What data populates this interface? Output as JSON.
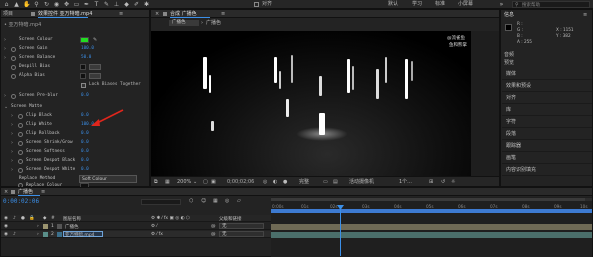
{
  "toolbar": {
    "snap_label": "对齐",
    "workspaces": [
      "默认",
      "学习",
      "标准",
      "小屏幕"
    ],
    "search_placeholder": "搜索帮助"
  },
  "left_panel": {
    "project_tab": "项目",
    "effects_tab": "效果控件 亚万特暗.mp4",
    "layer_label": "• 亚万特暗.mp4",
    "color_swatch": "#22dd22",
    "params": [
      {
        "name": "Screen Colour",
        "value": ""
      },
      {
        "name": "Screen Gain",
        "value": "100.0"
      },
      {
        "name": "Screen Balance",
        "value": "50.0"
      },
      {
        "name": "Despill Bias",
        "value": ""
      },
      {
        "name": "Alpha Bias",
        "value": ""
      },
      {
        "name": "Lock Biases Together",
        "value": ""
      },
      {
        "name": "Screen Pre-blur",
        "value": "0.0"
      },
      {
        "name": "Screen Matte",
        "value": ""
      },
      {
        "name": "Clip Black",
        "value": "0.0"
      },
      {
        "name": "Clip White",
        "value": "100.0"
      },
      {
        "name": "Clip Rollback",
        "value": "0.0"
      },
      {
        "name": "Screen Shrink/Grow",
        "value": "0.0"
      },
      {
        "name": "Screen Softness",
        "value": "0.0"
      },
      {
        "name": "Screen Despot Black",
        "value": "0.0"
      },
      {
        "name": "Screen Despot White",
        "value": "0.0"
      },
      {
        "name": "Replace Method",
        "value": "Soft Colour"
      },
      {
        "name": "Replace Colour",
        "value": ""
      }
    ]
  },
  "composition": {
    "tab_label": "合成 广播色",
    "sub_tab": "广播色",
    "watermark_line1": "@流雀鱼",
    "watermark_line2": "鱼和熊掌",
    "zoom": "200%",
    "timecode": "0;00;02;06",
    "quality": "完整",
    "camera": "活动摄像机",
    "views": "1个..."
  },
  "right_panel": {
    "info_tab": "信息",
    "color_readout": [
      "R :",
      "G :",
      "B :",
      "A : 255"
    ],
    "coords": [
      "X : 1151",
      "Y : 382"
    ],
    "audio_tab": "音频",
    "preview_tab": "预览",
    "items": [
      "媒体",
      "效果和预设",
      "对齐",
      "库",
      "字符",
      "段落",
      "跟踪器",
      "画笔",
      "内容识别填充"
    ],
    "item_labels_short": [
      "音频",
      "媒体",
      "效果和预设",
      "对齐",
      "库",
      "字符",
      "段落",
      "跟踪器"
    ]
  },
  "timeline": {
    "tab_label": "广播色",
    "timecode": "0:00:02:06",
    "column_name": "图层名称",
    "column_parent": "父级和链接",
    "layers": [
      {
        "num": "1",
        "name": "广播色",
        "parent": "无"
      },
      {
        "num": "2",
        "name": "亚万特暗.mp4",
        "parent": "无"
      }
    ],
    "ruler": [
      "0:00s",
      "01s",
      "02s",
      "03s",
      "04s",
      "05s",
      "06s",
      "07s",
      "08s",
      "09s",
      "10s"
    ]
  },
  "colors": {
    "accent": "#3b8fe8",
    "layer1": "#6f6a55",
    "layer2": "#4b6f6b",
    "work_area": "#3d7ad0"
  }
}
